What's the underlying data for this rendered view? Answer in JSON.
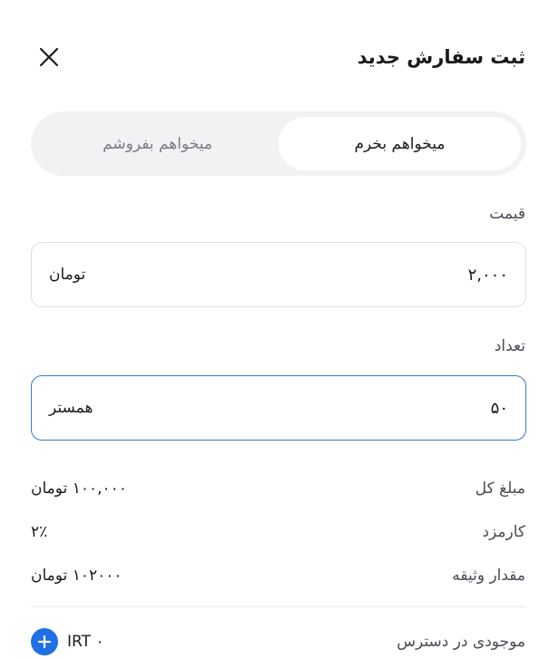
{
  "header": {
    "title": "ثبت سفارش جدید"
  },
  "side_toggle": {
    "buy_label": "میخواهم بخرم",
    "sell_label": "میخواهم بفروشم",
    "selected": "buy"
  },
  "price": {
    "label": "قیمت",
    "value": "۲,۰۰۰",
    "unit": "تومان"
  },
  "quantity": {
    "label": "تعداد",
    "value": "۵۰",
    "unit": "همستر"
  },
  "summary": {
    "total_label": "مبلغ کل",
    "total_value": "۱۰۰,۰۰۰ تومان",
    "fee_label": "کارمزد",
    "fee_value": "۲٪",
    "collateral_label": "مقدار وثیقه",
    "collateral_value": "۱۰۲۰۰۰ تومان"
  },
  "balance": {
    "label": "موجودی در دسترس",
    "value": "۰ IRT"
  },
  "colors": {
    "accent": "#1f6fe5",
    "focus_border": "#2e7bd6",
    "segment_bg": "#f1f2f4"
  }
}
